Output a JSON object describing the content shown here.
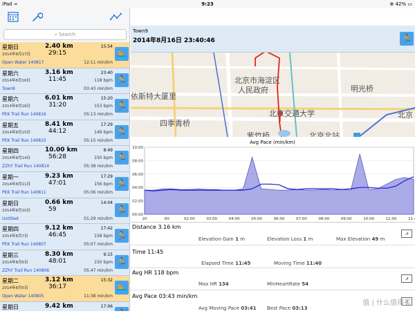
{
  "status": {
    "carrier": "iPad ≈",
    "time": "9:23",
    "battery": "⊕ 42% ▭"
  },
  "search": {
    "placeholder": "Search"
  },
  "activities": [
    {
      "day": "星期日",
      "dist": "2.40 km",
      "time": "15:54",
      "date": "2014年8月17日",
      "dur": "29:15",
      "bpm": "",
      "name": "Open Water 140817",
      "pace": "12:11 min/km",
      "hl": true,
      "type": "swim"
    },
    {
      "day": "星期六",
      "dist": "3.16 km",
      "time": "23:40",
      "date": "2014年8月16日",
      "dur": "11:45",
      "bpm": "118 bpm",
      "name": "Town9",
      "pace": "03:43 min/km",
      "hl": false,
      "type": "run"
    },
    {
      "day": "星期六",
      "dist": "6.01 km",
      "time": "15:20",
      "date": "2014年8月16日",
      "dur": "31:20",
      "bpm": "153 bpm",
      "name": "PEK Trail Run 140816",
      "pace": "05:13 min/km",
      "hl": false,
      "type": "run"
    },
    {
      "day": "星期五",
      "dist": "8.41 km",
      "time": "17:29",
      "date": "2014年8月15日",
      "dur": "44:12",
      "bpm": "149 bpm",
      "name": "PEK Trail Run 140815",
      "pace": "05:15 min/km",
      "hl": false,
      "type": "run"
    },
    {
      "day": "星期四",
      "dist": "10.00 km",
      "time": "8:49",
      "date": "2014年8月14日",
      "dur": "56:28",
      "bpm": "150 bpm",
      "name": "ZZhY Trail Run 140814",
      "pace": "05:38 min/km",
      "hl": false,
      "type": "run"
    },
    {
      "day": "星期一",
      "dist": "9.23 km",
      "time": "17:29",
      "date": "2014年8月11日",
      "dur": "47:01",
      "bpm": "156 bpm",
      "name": "PEK Trail Run 140811",
      "pace": "05:06 min/km",
      "hl": false,
      "type": "run"
    },
    {
      "day": "星期日",
      "dist": "0.66 km",
      "time": "14:04",
      "date": "2014年8月10日",
      "dur": "59",
      "bpm": "",
      "name": "Untitled",
      "pace": "01:29 min/km",
      "hl": false,
      "type": "run"
    },
    {
      "day": "星期四",
      "dist": "9.12 km",
      "time": "17:42",
      "date": "2014年8月7日",
      "dur": "46:45",
      "bpm": "158 bpm",
      "name": "PEK Trail Run 140807",
      "pace": "05:07 min/km",
      "hl": false,
      "type": "run"
    },
    {
      "day": "星期三",
      "dist": "8.30 km",
      "time": "9:15",
      "date": "2014年8月6日",
      "dur": "48:01",
      "bpm": "150 bpm",
      "name": "ZZhY Trail Run 140806",
      "pace": "05:47 min/km",
      "hl": false,
      "type": "run"
    },
    {
      "day": "星期二",
      "dist": "3.12 km",
      "time": "15:32",
      "date": "2014年8月5日",
      "dur": "36:17",
      "bpm": "",
      "name": "Open Water 140805",
      "pace": "11:38 min/km",
      "hl": true,
      "type": "swim"
    },
    {
      "day": "星期日",
      "dist": "9.42 km",
      "time": "17:06",
      "date": "",
      "dur": "",
      "bpm": "",
      "name": "",
      "pace": "",
      "hl": false,
      "type": "run"
    }
  ],
  "header": {
    "title": "Town9",
    "datetime": "2014年8月16日 23:40:46"
  },
  "map": {
    "labels": [
      "北京市海淀区",
      "人民政府",
      "北京交通大学",
      "明光桥",
      "北京北站",
      "紫竹桥",
      "四季青桥",
      "依斯特大厦里",
      "北京"
    ]
  },
  "chart_data": {
    "type": "area",
    "title": "Avg Pace (min/km)",
    "ylim": [
      0,
      10
    ],
    "y_ticks": [
      "00:00",
      "02:00",
      "04:00",
      "06:00",
      "08:00",
      "10:00"
    ],
    "x_ticks": [
      "20",
      "60",
      "02:00",
      "03:00",
      "04:00",
      "05:00",
      "06:00",
      "07:00",
      "08:00",
      "09:00",
      "10:00",
      "11:00",
      "11:46"
    ],
    "series": [
      {
        "name": "",
        "values": [
          3.6,
          3.6,
          3.8,
          3.8,
          3.7,
          3.7,
          3.8,
          3.7,
          3.7,
          3.6,
          3.6,
          3.8,
          8.5,
          3.8,
          3.7,
          3.6,
          3.6,
          3.7,
          3.6,
          3.6,
          3.7,
          3.6,
          3.7,
          3.6,
          9.0,
          3.7,
          3.8,
          4.5,
          5.2,
          5.5,
          5.2
        ]
      },
      {
        "name": "",
        "values": [
          3.6,
          3.5,
          3.6,
          3.7,
          3.6,
          3.6,
          3.6,
          3.6,
          3.6,
          3.6,
          3.6,
          3.6,
          3.8,
          4.5,
          4.5,
          4.4,
          3.8,
          3.7,
          3.8,
          3.8,
          3.8,
          3.8,
          3.7,
          3.8,
          4.0,
          4.0,
          3.9,
          3.9,
          4.2,
          5.0,
          5.6
        ]
      }
    ]
  },
  "stats": {
    "distance": {
      "label": "Distance",
      "value": "3.16",
      "unit": "km",
      "sub": [
        [
          "Elevation Gain",
          "1",
          "m"
        ],
        [
          "Elevation Loss",
          "1",
          "m"
        ],
        [
          "Max Elevation",
          "49",
          "m"
        ]
      ]
    },
    "time": {
      "label": "Time",
      "value": "11:45",
      "sub": [
        [
          "Elapsed Time",
          "11:45",
          ""
        ],
        [
          "Moving Time",
          "11:40",
          ""
        ]
      ]
    },
    "hr": {
      "label": "Avg HR",
      "value": "118",
      "unit": "bpm",
      "sub": [
        [
          "Max HR",
          "134",
          ""
        ],
        [
          "MinHeartRate",
          "54",
          ""
        ]
      ]
    },
    "pace": {
      "label": "Avg Pace",
      "value": "03:43",
      "unit": "min/km",
      "sub": [
        [
          "Avg Moving Pace",
          "03:41",
          ""
        ],
        [
          "Best Pace",
          "03:13",
          ""
        ]
      ]
    }
  },
  "watermark": "值 | 什么值得买"
}
